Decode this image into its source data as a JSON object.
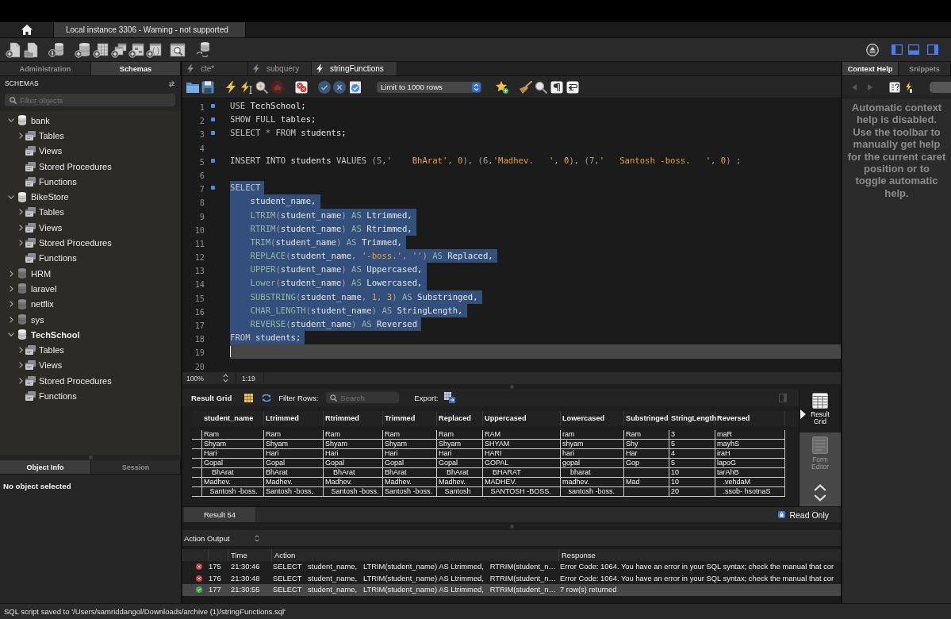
{
  "window": {
    "connection_tab": "Local instance 3306 - Warning - not supported"
  },
  "sidebar": {
    "tabs": [
      {
        "label": "Administration",
        "selected": false
      },
      {
        "label": "Schemas",
        "selected": true
      }
    ],
    "title": "SCHEMAS",
    "filter": {
      "placeholder": "Filter objects"
    },
    "schemas": [
      {
        "name": "bank",
        "expanded": true,
        "default": false,
        "children": [
          {
            "label": "Tables",
            "expandable": true
          },
          {
            "label": "Views",
            "expandable": false
          },
          {
            "label": "Stored Procedures",
            "expandable": false
          },
          {
            "label": "Functions",
            "expandable": false
          }
        ]
      },
      {
        "name": "BikeStore",
        "expanded": true,
        "default": false,
        "children": [
          {
            "label": "Tables",
            "expandable": true
          },
          {
            "label": "Views",
            "expandable": true
          },
          {
            "label": "Stored Procedures",
            "expandable": true
          },
          {
            "label": "Functions",
            "expandable": false
          }
        ]
      },
      {
        "name": "HRM",
        "expanded": false,
        "default": false
      },
      {
        "name": "laravel",
        "expanded": false,
        "default": false
      },
      {
        "name": "netflix",
        "expanded": false,
        "default": false
      },
      {
        "name": "sys",
        "expanded": false,
        "default": false
      },
      {
        "name": "TechSchool",
        "expanded": true,
        "default": true,
        "children": [
          {
            "label": "Tables",
            "expandable": true
          },
          {
            "label": "Views",
            "expandable": true
          },
          {
            "label": "Stored Procedures",
            "expandable": true
          },
          {
            "label": "Functions",
            "expandable": false
          }
        ]
      }
    ],
    "info_tabs": [
      {
        "label": "Object Info",
        "selected": true
      },
      {
        "label": "Session",
        "selected": false
      }
    ],
    "info_text": "No object selected"
  },
  "editor": {
    "tabs": [
      {
        "label": "cte*",
        "selected": false
      },
      {
        "label": "subquery",
        "selected": false
      },
      {
        "label": "stringFunctions",
        "selected": true
      }
    ],
    "limit_select": "Limit to 1000 rows",
    "zoom": "100%",
    "cursor_position": "1:19",
    "lines": [
      {
        "number": "1",
        "marker": true,
        "highlighted": false,
        "current": false,
        "tokens": [
          {
            "text": "USE",
            "kind": "keyword"
          },
          {
            "text": " TechSchool;",
            "kind": "name"
          }
        ]
      },
      {
        "number": "2",
        "marker": true,
        "highlighted": false,
        "current": false,
        "tokens": [
          {
            "text": "SHOW FULL",
            "kind": "keyword"
          },
          {
            "text": " tables;",
            "kind": "name"
          }
        ]
      },
      {
        "number": "3",
        "marker": true,
        "highlighted": false,
        "current": false,
        "tokens": [
          {
            "text": "SELECT",
            "kind": "keyword"
          },
          {
            "text": " * ",
            "kind": "symbol"
          },
          {
            "text": "FROM",
            "kind": "keyword"
          },
          {
            "text": " students;",
            "kind": "name"
          }
        ]
      },
      {
        "number": "4",
        "marker": false,
        "highlighted": false,
        "current": false
      },
      {
        "number": "5",
        "marker": true,
        "highlighted": false,
        "current": false,
        "tokens": [
          {
            "text": "INSERT INTO",
            "kind": "keyword"
          },
          {
            "text": " students ",
            "kind": "name"
          },
          {
            "text": "VALUES",
            "kind": "keyword"
          },
          {
            "text": " (5,",
            "kind": "symbol"
          },
          {
            "text": "'    BhArat'",
            "kind": "literal"
          },
          {
            "text": ", ",
            "kind": "symbol"
          },
          {
            "text": "0",
            "kind": "literal"
          },
          {
            "text": "), (6,",
            "kind": "symbol"
          },
          {
            "text": "'Madhev.   '",
            "kind": "literal"
          },
          {
            "text": ", ",
            "kind": "symbol"
          },
          {
            "text": "0",
            "kind": "literal"
          },
          {
            "text": "), (7,",
            "kind": "symbol"
          },
          {
            "text": "'   Santosh -boss.   '",
            "kind": "literal"
          },
          {
            "text": ", ",
            "kind": "symbol"
          },
          {
            "text": "0",
            "kind": "literal"
          },
          {
            "text": ") ;",
            "kind": "symbol"
          }
        ]
      },
      {
        "number": "6",
        "marker": false,
        "highlighted": false,
        "current": false
      },
      {
        "number": "7",
        "marker": true,
        "highlighted": true,
        "current": false,
        "tokens": [
          {
            "text": "SELECT",
            "kind": "keyword"
          }
        ]
      },
      {
        "number": "8",
        "marker": false,
        "highlighted": true,
        "current": false,
        "tokens": [
          {
            "text": "    student_name,",
            "kind": "name"
          }
        ]
      },
      {
        "number": "9",
        "marker": false,
        "highlighted": true,
        "current": false,
        "tokens": [
          {
            "text": "    LTRIM",
            "kind": "builtin"
          },
          {
            "text": "(",
            "kind": "symbol"
          },
          {
            "text": "student_name",
            "kind": "name"
          },
          {
            "text": ") ",
            "kind": "symbol"
          },
          {
            "text": "AS",
            "kind": "builtin"
          },
          {
            "text": " Ltrimmed,",
            "kind": "name"
          }
        ]
      },
      {
        "number": "10",
        "marker": false,
        "highlighted": true,
        "current": false,
        "tokens": [
          {
            "text": "    RTRIM",
            "kind": "builtin"
          },
          {
            "text": "(",
            "kind": "symbol"
          },
          {
            "text": "student_name",
            "kind": "name"
          },
          {
            "text": ") ",
            "kind": "symbol"
          },
          {
            "text": "AS",
            "kind": "builtin"
          },
          {
            "text": " Rtrimmed,",
            "kind": "name"
          }
        ]
      },
      {
        "number": "11",
        "marker": false,
        "highlighted": true,
        "current": false,
        "tokens": [
          {
            "text": "    TRIM",
            "kind": "builtin"
          },
          {
            "text": "(",
            "kind": "symbol"
          },
          {
            "text": "student_name",
            "kind": "name"
          },
          {
            "text": ") ",
            "kind": "symbol"
          },
          {
            "text": "AS",
            "kind": "builtin"
          },
          {
            "text": " Trimmed,",
            "kind": "name"
          }
        ]
      },
      {
        "number": "12",
        "marker": false,
        "highlighted": true,
        "current": false,
        "tokens": [
          {
            "text": "    REPLACE",
            "kind": "builtin"
          },
          {
            "text": "(",
            "kind": "symbol"
          },
          {
            "text": "student_name",
            "kind": "name"
          },
          {
            "text": ", ",
            "kind": "symbol"
          },
          {
            "text": "'-boss.'",
            "kind": "literal"
          },
          {
            "text": ", ",
            "kind": "symbol"
          },
          {
            "text": "''",
            "kind": "literal"
          },
          {
            "text": ") ",
            "kind": "symbol"
          },
          {
            "text": "AS",
            "kind": "builtin"
          },
          {
            "text": " Replaced,",
            "kind": "name"
          }
        ]
      },
      {
        "number": "13",
        "marker": false,
        "highlighted": true,
        "current": false,
        "tokens": [
          {
            "text": "    UPPER",
            "kind": "builtin"
          },
          {
            "text": "(",
            "kind": "symbol"
          },
          {
            "text": "student_name",
            "kind": "name"
          },
          {
            "text": ") ",
            "kind": "symbol"
          },
          {
            "text": "AS",
            "kind": "builtin"
          },
          {
            "text": " Uppercased,",
            "kind": "name"
          }
        ]
      },
      {
        "number": "14",
        "marker": false,
        "highlighted": true,
        "current": false,
        "tokens": [
          {
            "text": "    Lower",
            "kind": "builtin"
          },
          {
            "text": "(",
            "kind": "symbol"
          },
          {
            "text": "student_name",
            "kind": "name"
          },
          {
            "text": ") ",
            "kind": "symbol"
          },
          {
            "text": "AS",
            "kind": "builtin"
          },
          {
            "text": " Lowercased,",
            "kind": "name"
          }
        ]
      },
      {
        "number": "15",
        "marker": false,
        "highlighted": true,
        "current": false,
        "tokens": [
          {
            "text": "    SUBSTRING",
            "kind": "builtin"
          },
          {
            "text": "(",
            "kind": "symbol"
          },
          {
            "text": "student_name",
            "kind": "name"
          },
          {
            "text": ", ",
            "kind": "symbol"
          },
          {
            "text": "1",
            "kind": "literal"
          },
          {
            "text": ", ",
            "kind": "symbol"
          },
          {
            "text": "3",
            "kind": "literal"
          },
          {
            "text": ") ",
            "kind": "symbol"
          },
          {
            "text": "AS",
            "kind": "builtin"
          },
          {
            "text": " Substringed,",
            "kind": "name"
          }
        ]
      },
      {
        "number": "16",
        "marker": false,
        "highlighted": true,
        "current": false,
        "tokens": [
          {
            "text": "    CHAR_LENGTH",
            "kind": "builtin"
          },
          {
            "text": "(",
            "kind": "symbol"
          },
          {
            "text": "student_name",
            "kind": "name"
          },
          {
            "text": ") ",
            "kind": "symbol"
          },
          {
            "text": "AS",
            "kind": "builtin"
          },
          {
            "text": " StringLength,",
            "kind": "name"
          }
        ]
      },
      {
        "number": "17",
        "marker": false,
        "highlighted": true,
        "current": false,
        "tokens": [
          {
            "text": "    REVERSE",
            "kind": "builtin"
          },
          {
            "text": "(",
            "kind": "symbol"
          },
          {
            "text": "student_name",
            "kind": "name"
          },
          {
            "text": ") ",
            "kind": "symbol"
          },
          {
            "text": "AS",
            "kind": "builtin"
          },
          {
            "text": " Reversed",
            "kind": "name"
          }
        ]
      },
      {
        "number": "18",
        "marker": false,
        "highlighted": true,
        "current": false,
        "tokens": [
          {
            "text": "FROM",
            "kind": "keyword"
          },
          {
            "text": " students;",
            "kind": "name"
          }
        ]
      },
      {
        "number": "19",
        "marker": false,
        "highlighted": false,
        "current": true
      },
      {
        "number": "20",
        "marker": false,
        "highlighted": false,
        "current": false
      }
    ]
  },
  "result": {
    "toolbar_label": "Result Grid",
    "filter_label": "Filter Rows:",
    "search": {
      "placeholder": "Search"
    },
    "export_label": "Export:",
    "columns": [
      "student_name",
      "Ltrimmed",
      "Rtrimmed",
      "Trimmed",
      "Replaced",
      "Uppercased",
      "Lowercased",
      "Substringed",
      "StringLength",
      "Reversed"
    ],
    "rows": [
      [
        "Ram",
        "Ram",
        "Ram",
        "Ram",
        "Ram",
        "RAM",
        "ram",
        "Ram",
        "3",
        "maR"
      ],
      [
        "Shyam",
        "Shyam",
        "Shyam",
        "Shyam",
        "Shyam",
        "SHYAM",
        "shyam",
        "Shy",
        "5",
        "mayhS"
      ],
      [
        "Hari",
        "Hari",
        "Hari",
        "Hari",
        "Hari",
        "HARI",
        "hari",
        "Har",
        "4",
        "iraH"
      ],
      [
        "Gopal",
        "Gopal",
        "Gopal",
        "Gopal",
        "Gopal",
        "GOPAL",
        "gopal",
        "Gop",
        "5",
        "lapoG"
      ],
      [
        "    BhArat",
        "BhArat",
        "    BhArat",
        "BhArat",
        "    BhArat",
        "    BHARAT",
        "    bharat",
        null,
        "10",
        "tarAhB"
      ],
      [
        "Madhev.",
        "Madhev.",
        "Madhev.",
        "Madhev.",
        "Madhev.",
        "MADHEV.",
        "madhev.",
        "Mad",
        "10",
        "   .vehdaM"
      ],
      [
        "   Santosh -boss.",
        "Santosh -boss.",
        "   Santosh -boss.",
        "Santosh -boss.",
        "   Santosh",
        "   SANTOSH -BOSS.",
        "   santosh -boss.",
        null,
        "20",
        "   .ssob- hsotnaS"
      ]
    ],
    "views": [
      {
        "label": "Result Grid",
        "selected": true
      },
      {
        "label": "Form Editor",
        "selected": false
      }
    ],
    "tabs": [
      {
        "label": "Result 54",
        "selected": true
      }
    ],
    "read_only": "Read Only"
  },
  "action_output": {
    "title": "Action Output",
    "columns": [
      "Time",
      "Action",
      "Response"
    ],
    "rows": [
      {
        "kind": "error",
        "number": "175",
        "time": "21:30:46",
        "action": "SELECT   student_name,   LTRIM(student_name) AS Ltrimmed,   RTRIM(student_n…",
        "response": "Error Code: 1064. You have an error in your SQL syntax; check the manual that cor",
        "selected": false
      },
      {
        "kind": "error",
        "number": "176",
        "time": "21:30:48",
        "action": "SELECT   student_name,   LTRIM(student_name) AS Ltrimmed,   RTRIM(student_n…",
        "response": "Error Code: 1064. You have an error in your SQL syntax; check the manual that cor",
        "selected": false
      },
      {
        "kind": "success",
        "number": "177",
        "time": "21:30:55",
        "action": "SELECT   student_name,   LTRIM(student_name) AS Ltrimmed,   RTRIM(student_n…",
        "response": "7 row(s) returned",
        "selected": true
      }
    ]
  },
  "context_help": {
    "tabs": [
      {
        "label": "Context Help",
        "selected": true
      },
      {
        "label": "Snippets",
        "selected": false
      }
    ],
    "text": "Automatic context help is disabled. Use the toolbar to manually get help for the current caret position or to toggle automatic help."
  },
  "status_bar": "SQL script saved to '/Users/samriddangol/Downloads/archive (1)/stringFunctions.sql'"
}
